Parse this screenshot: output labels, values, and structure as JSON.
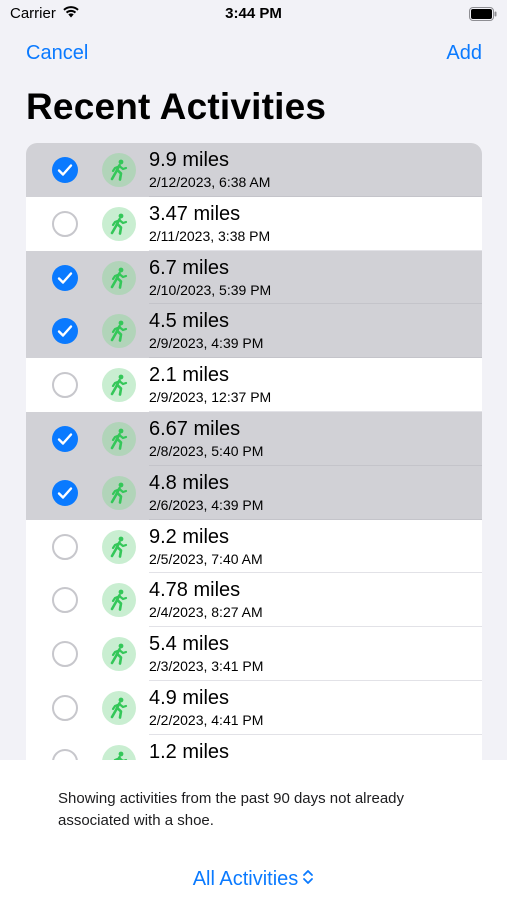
{
  "status_bar": {
    "carrier": "Carrier",
    "time": "3:44 PM"
  },
  "nav": {
    "cancel": "Cancel",
    "add": "Add"
  },
  "title": "Recent Activities",
  "activities": [
    {
      "distance": "9.9 miles",
      "date": "2/12/2023, 6:38 AM",
      "selected": true
    },
    {
      "distance": "3.47 miles",
      "date": "2/11/2023, 3:38 PM",
      "selected": false
    },
    {
      "distance": "6.7 miles",
      "date": "2/10/2023, 5:39 PM",
      "selected": true
    },
    {
      "distance": "4.5 miles",
      "date": "2/9/2023, 4:39 PM",
      "selected": true
    },
    {
      "distance": "2.1 miles",
      "date": "2/9/2023, 12:37 PM",
      "selected": false
    },
    {
      "distance": "6.67 miles",
      "date": "2/8/2023, 5:40 PM",
      "selected": true
    },
    {
      "distance": "4.8 miles",
      "date": "2/6/2023, 4:39 PM",
      "selected": true
    },
    {
      "distance": "9.2 miles",
      "date": "2/5/2023, 7:40 AM",
      "selected": false
    },
    {
      "distance": "4.78 miles",
      "date": "2/4/2023, 8:27 AM",
      "selected": false
    },
    {
      "distance": "5.4 miles",
      "date": "2/3/2023, 3:41 PM",
      "selected": false
    },
    {
      "distance": "4.9 miles",
      "date": "2/2/2023, 4:41 PM",
      "selected": false
    },
    {
      "distance": "1.2 miles",
      "date": "",
      "selected": false
    }
  ],
  "activity_icon": "running-figure-icon",
  "footer": {
    "note": "Showing activities from the past 90 days not already associated with a shoe.",
    "filter_label": "All Activities"
  },
  "colors": {
    "accent": "#0a7aff",
    "selected_row": "#d1d1d6",
    "icon_bg": "#c9eed1",
    "icon_fg": "#34c759"
  }
}
